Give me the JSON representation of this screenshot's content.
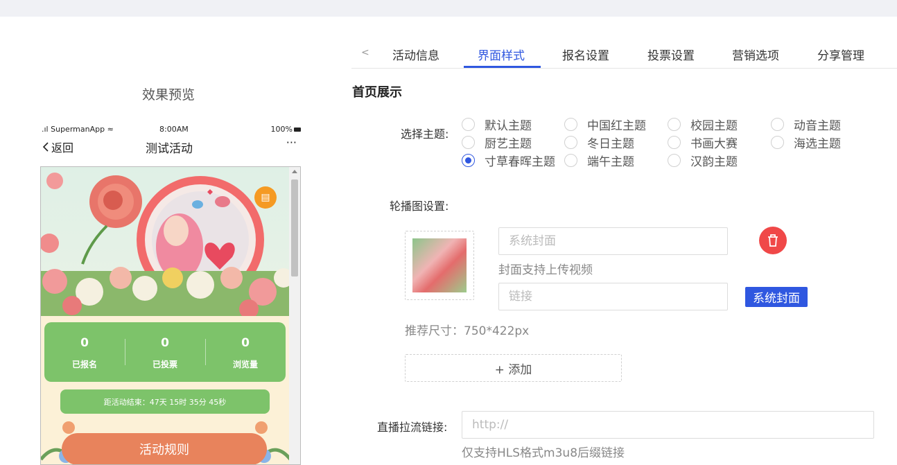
{
  "preview": {
    "title": "效果预览",
    "status": {
      "carrier": "SupermanApp",
      "time": "8:00AM",
      "battery": "100%"
    },
    "nav": {
      "back_label": "返回",
      "title": "测试活动",
      "more": "···"
    },
    "stats": [
      {
        "value": "0",
        "label": "已报名"
      },
      {
        "value": "0",
        "label": "已投票"
      },
      {
        "value": "0",
        "label": "浏览量"
      }
    ],
    "countdown": "距活动结束：47天 15时 35分 45秒",
    "rules_label": "活动规则",
    "colors": {
      "card_green": "#7dc36a",
      "rules_orange": "#e8835c",
      "badge_orange": "#f59a23"
    }
  },
  "tabs": {
    "items": [
      "活动信息",
      "界面样式",
      "报名设置",
      "投票设置",
      "营销选项",
      "分享管理"
    ],
    "active_index": 1,
    "accent": "#2f57e0"
  },
  "homepage": {
    "section_title": "首页展示",
    "theme_label": "选择主题:",
    "themes": [
      {
        "label": "默认主题",
        "checked": false
      },
      {
        "label": "中国红主题",
        "checked": false
      },
      {
        "label": "校园主题",
        "checked": false
      },
      {
        "label": "动音主题",
        "checked": false
      },
      {
        "label": "厨艺主题",
        "checked": false
      },
      {
        "label": "冬日主题",
        "checked": false
      },
      {
        "label": "书画大赛",
        "checked": false
      },
      {
        "label": "海选主题",
        "checked": false
      },
      {
        "label": "寸草春晖主题",
        "checked": true
      },
      {
        "label": "端午主题",
        "checked": false
      },
      {
        "label": "汉韵主题",
        "checked": false
      }
    ],
    "carousel_label": "轮播图设置:",
    "cover_placeholder": "系统封面",
    "cover_hint": "封面支持上传视频",
    "link_placeholder": "链接",
    "system_cover_button": "系统封面",
    "size_hint": "推荐尺寸：750*422px",
    "add_label": "+ 添加",
    "stream_label": "直播拉流链接:",
    "stream_placeholder": "http://",
    "stream_hint": "仅支持HLS格式m3u8后缀链接"
  }
}
